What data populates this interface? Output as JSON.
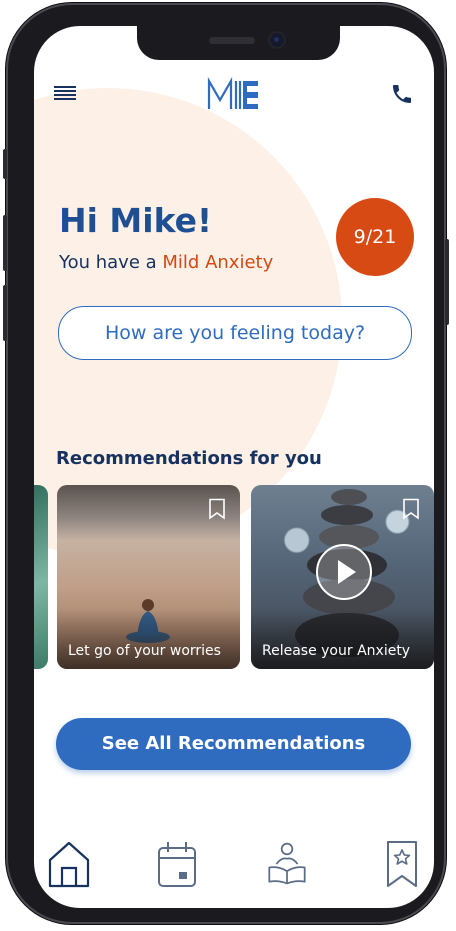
{
  "header": {
    "logo_text": "MIE",
    "menu_icon": "hamburger-menu-icon",
    "call_icon": "phone-icon"
  },
  "greeting": {
    "title": "Hi Mike!",
    "subtitle_prefix": "You have a ",
    "severity": "Mild Anxiety",
    "score": "9/21"
  },
  "feeling_button": {
    "label": "How are you feeling today?"
  },
  "recommendations": {
    "title": "Recommendations for you",
    "cards": [
      {
        "label": "Let go of your worries",
        "icon": "bookmark-icon"
      },
      {
        "label": "Release your Anxiety",
        "icon": "bookmark-icon",
        "media": "play-icon"
      }
    ],
    "see_all_label": "See All Recommendations"
  },
  "bottom_nav": {
    "items": [
      "home-icon",
      "calendar-icon",
      "reading-icon",
      "saved-icon"
    ]
  },
  "colors": {
    "primary": "#2f6cc0",
    "navy": "#17325f",
    "accent": "#d84a14",
    "blob": "#fdf0e6"
  }
}
